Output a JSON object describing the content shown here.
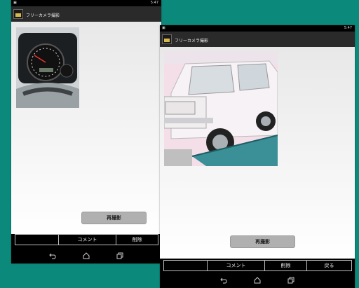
{
  "colors": {
    "background": "#0b8a7b",
    "button": "#b0b0b0",
    "toolbar": "#000000"
  },
  "back_screen": {
    "status_time": "5:47",
    "app_title": "フリーカメラ撮影",
    "retake_label": "再撮影",
    "toolbar": [
      "",
      "コメント",
      "削除"
    ],
    "photo": "speedometer-photo"
  },
  "front_screen": {
    "status_time": "5:47",
    "app_title": "フリーカメラ撮影",
    "retake_label": "再撮影",
    "toolbar": [
      "",
      "コメント",
      "削除",
      "戻る"
    ],
    "photo": "white-car-photo"
  },
  "navbar_icons": [
    "back-icon",
    "home-icon",
    "recents-icon"
  ]
}
